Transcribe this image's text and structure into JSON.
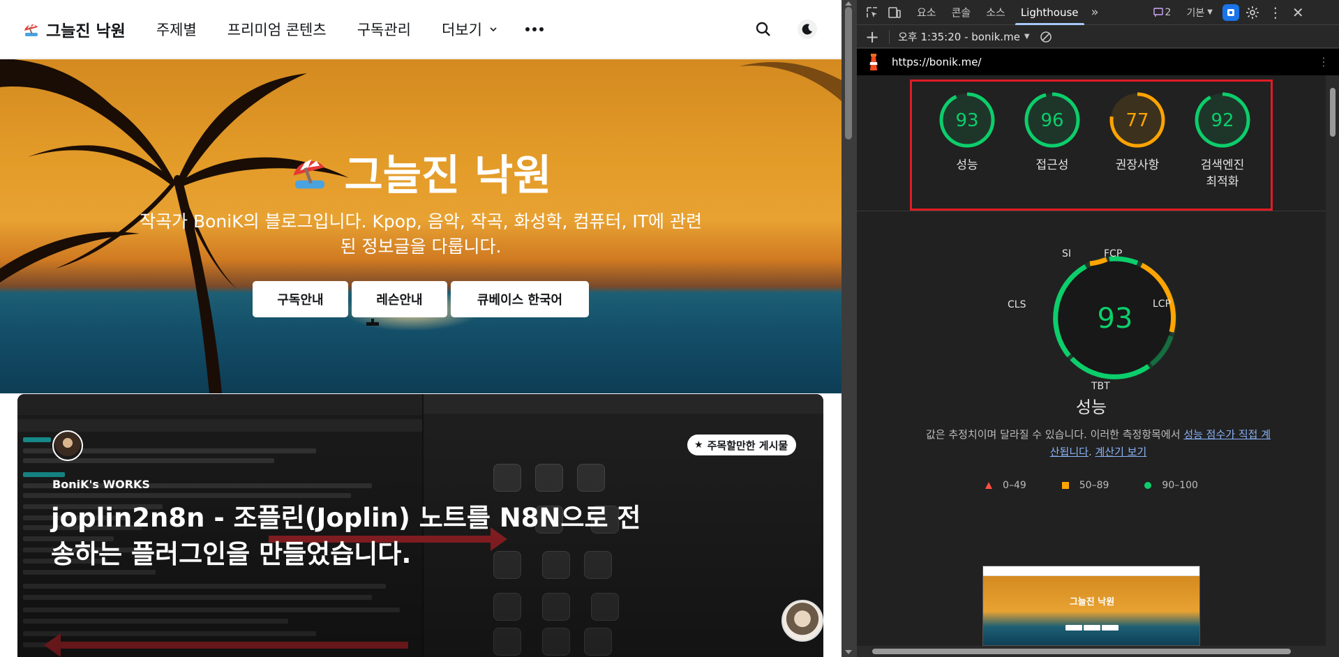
{
  "blog": {
    "logo_text": "그늘진 낙원",
    "nav": {
      "items": [
        "주제별",
        "프리미엄 콘텐츠",
        "구독관리",
        "더보기"
      ]
    },
    "hero": {
      "title": "그늘진 낙원",
      "description": "작곡가 BoniK의 블로그입니다. Kpop, 음악, 작곡, 화성학, 컴퓨터, IT에 관련된 정보글을 다룹니다.",
      "buttons": [
        "구독안내",
        "레슨안내",
        "큐베이스 한국어"
      ]
    },
    "featured": {
      "badge": "주목할만한 게시물",
      "author": "BoniK's WORKS",
      "title": "joplin2n8n - 조플린(Joplin) 노트를 N8N으로 전송하는 플러그인을 만들었습니다."
    }
  },
  "devtools": {
    "tabs": [
      "요소",
      "콘솔",
      "소스",
      "Lighthouse"
    ],
    "active_tab": "Lighthouse",
    "issues_count": "2",
    "dock_label": "기본",
    "report_label": "오후 1:35:20 - bonik.me",
    "url": "https://bonik.me/",
    "scores": [
      {
        "value": 93,
        "label": "성능",
        "color": "#0cce6b"
      },
      {
        "value": 96,
        "label": "접근성",
        "color": "#0cce6b"
      },
      {
        "value": 77,
        "label": "권장사항",
        "color": "#ffa400"
      },
      {
        "value": 92,
        "label": "검색엔진 최적화",
        "color": "#0cce6b"
      }
    ],
    "score_labels_split": [
      "성능",
      "접근성",
      "권장사항",
      "검색엔진",
      "최적화"
    ],
    "performance": {
      "score": 93,
      "title": "성능",
      "metrics": [
        "SI",
        "FCP",
        "LCP",
        "TBT",
        "CLS"
      ],
      "note_prefix": "값은 추정치이며 달라질 수 있습니다. 이러한 측정항목에서 ",
      "note_link1": "성능 점수가 직접 계산됩니다",
      "note_sep": ". ",
      "note_link2": "계산기 보기",
      "legend": [
        {
          "range": "0–49",
          "color": "#ff4e42",
          "shape": "triangle"
        },
        {
          "range": "50–89",
          "color": "#ffa400",
          "shape": "square"
        },
        {
          "range": "90–100",
          "color": "#0cce6b",
          "shape": "circle"
        }
      ]
    },
    "thumbnail_title": "그늘진 낙원"
  }
}
